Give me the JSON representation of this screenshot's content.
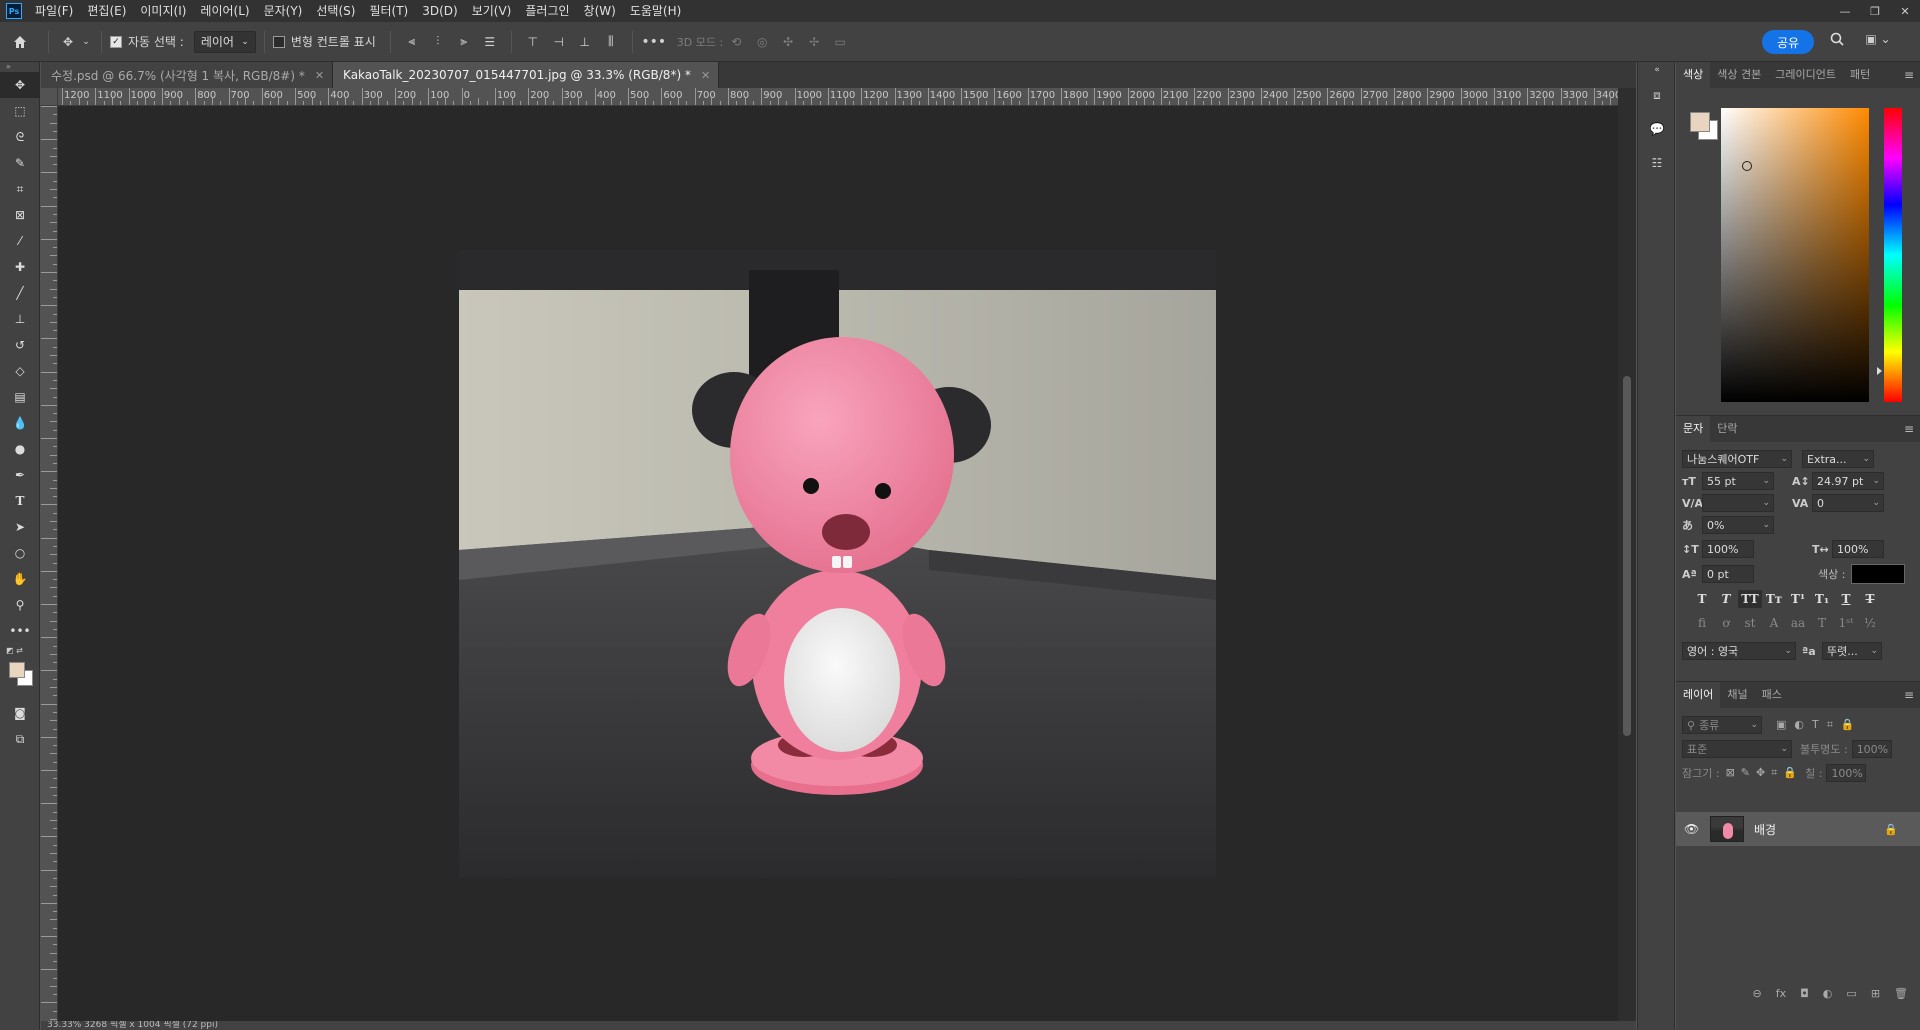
{
  "menu": [
    "파일(F)",
    "편집(E)",
    "이미지(I)",
    "레이어(L)",
    "문자(Y)",
    "선택(S)",
    "필터(T)",
    "3D(D)",
    "보기(V)",
    "플러그인",
    "창(W)",
    "도움말(H)"
  ],
  "ps_logo": "Ps",
  "options": {
    "auto_select_label": "자동 선택 :",
    "auto_select_value": "레이어",
    "transform_label": "변형 컨트롤 표시",
    "mode_3d_label": "3D 모드 :",
    "share_label": "공유"
  },
  "tabs": [
    {
      "label": "수정.psd @ 66.7% (사각형 1 복사, RGB/8#) *",
      "active": false
    },
    {
      "label": "KakaoTalk_20230707_015447701.jpg @ 33.3% (RGB/8*) *",
      "active": true
    }
  ],
  "ruler_labels": [
    "1200",
    "1100",
    "1000",
    "900",
    "800",
    "700",
    "600",
    "500",
    "400",
    "300",
    "200",
    "100",
    "0",
    "100",
    "200",
    "300",
    "400",
    "500",
    "600",
    "700",
    "800",
    "900",
    "1000",
    "1100",
    "1200",
    "1300",
    "1400",
    "1500",
    "1600",
    "1700",
    "1800",
    "1900",
    "2000",
    "2100",
    "2200",
    "2300",
    "2400",
    "2500",
    "2600",
    "2700",
    "2800",
    "2900",
    "3000",
    "3100",
    "3200",
    "3300",
    "3400"
  ],
  "status_text": "33.33%    3268 픽셀 x 1004 픽셀 (72 ppi)",
  "color_panel": {
    "tabs": [
      "색상",
      "색상 견본",
      "그레이디언트",
      "패턴"
    ],
    "foreground": "#e8d4bf",
    "background": "#ffffff"
  },
  "character_panel": {
    "tabs": [
      "문자",
      "단락"
    ],
    "font_family": "나눔스퀘어OTF",
    "font_style": "Extra...",
    "font_size": "55 pt",
    "leading": "24.97 pt",
    "kerning": "",
    "tracking": "0",
    "tsume": "0%",
    "vertical_scale": "100%",
    "horizontal_scale": "100%",
    "baseline_shift": "0 pt",
    "color_label": "색상 :",
    "language": "영어 : 영국",
    "antialias": "뚜렷...",
    "antialias_icon": "ªa"
  },
  "layers_panel": {
    "tabs": [
      "레이어",
      "채널",
      "패스"
    ],
    "search_placeholder": "종류",
    "blend_mode": "표준",
    "opacity_label": "불투명도 :",
    "opacity": "100%",
    "lock_label": "잠그기 :",
    "fill_label": "칠 :",
    "fill": "100%",
    "layers": [
      {
        "name": "배경",
        "visible": true,
        "locked": true
      }
    ]
  }
}
